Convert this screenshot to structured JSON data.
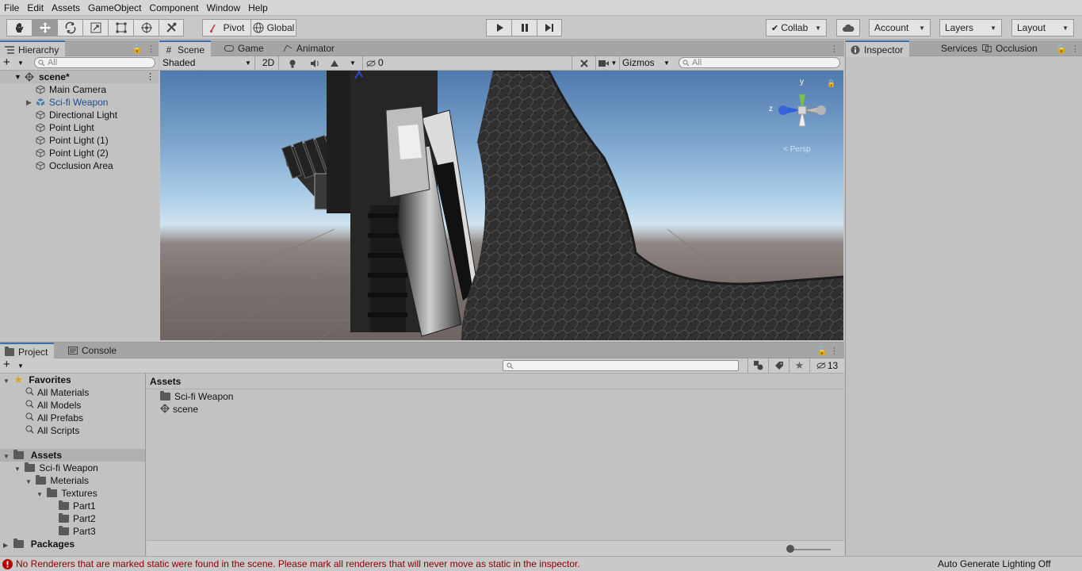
{
  "menu": [
    "File",
    "Edit",
    "Assets",
    "GameObject",
    "Component",
    "Window",
    "Help"
  ],
  "toolbar": {
    "tools": [
      "hand-tool",
      "move-tool",
      "rotate-tool",
      "scale-tool",
      "rect-tool",
      "transform-tool",
      "custom-tool"
    ],
    "pivot_label": "Pivot",
    "global_label": "Global",
    "collab_label": "Collab",
    "account_label": "Account",
    "layers_label": "Layers",
    "layout_label": "Layout"
  },
  "hierarchy": {
    "tab_label": "Hierarchy",
    "search_placeholder": "All",
    "scene_name": "scene*",
    "items": [
      "Main Camera",
      "Sci-fi Weapon",
      "Directional Light",
      "Point Light",
      "Point Light (1)",
      "Point Light (2)",
      "Occlusion Area"
    ]
  },
  "scene": {
    "tabs": [
      "Scene",
      "Game",
      "Animator"
    ],
    "shading_mode": "Shaded",
    "mode_2d": "2D",
    "hidden_count": "0",
    "gizmos_label": "Gizmos",
    "search_placeholder": "All",
    "gizmo_y": "y",
    "gizmo_z": "z",
    "gizmo_view": "< Persp"
  },
  "inspector": {
    "tabs": [
      "Inspector",
      "Services",
      "Occlusion"
    ]
  },
  "project": {
    "tabs": [
      "Project",
      "Console"
    ],
    "hidden_count": "13",
    "favorites_label": "Favorites",
    "favorites": [
      "All Materials",
      "All Models",
      "All Prefabs",
      "All Scripts"
    ],
    "assets_label": "Assets",
    "tree": [
      "Sci-fi Weapon",
      "Meterials",
      "Textures",
      "Part1",
      "Part2",
      "Part3"
    ],
    "packages_label": "Packages",
    "breadcrumb": "Assets",
    "files": [
      "Sci-fi Weapon",
      "scene"
    ]
  },
  "status": {
    "message": "No Renderers that are marked static were found in the scene. Please mark all renderers that will never move as static in the inspector.",
    "lighting": "Auto Generate Lighting Off",
    "error_color": "#b40000"
  }
}
